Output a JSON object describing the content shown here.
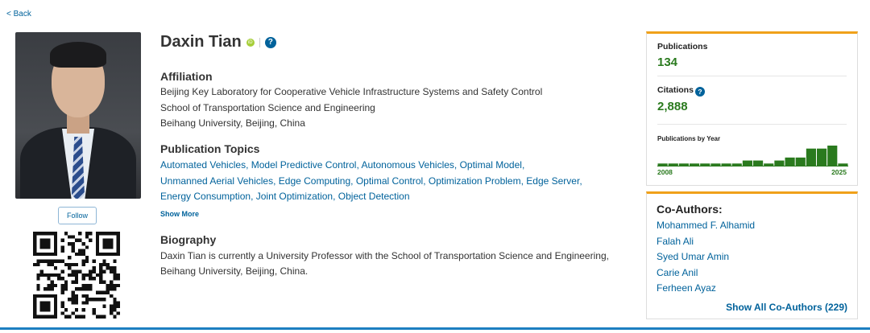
{
  "nav": {
    "back_label": "< Back"
  },
  "profile": {
    "name": "Daxin Tian",
    "orcid_badge": "iD",
    "help_glyph": "?",
    "follow_label": "Follow"
  },
  "affiliation": {
    "heading": "Affiliation",
    "lines": [
      "Beijing Key Laboratory for Cooperative Vehicle Infrastructure Systems and Safety Control",
      "School of Transportation Science and Engineering",
      "Beihang University, Beijing, China"
    ]
  },
  "topics": {
    "heading": "Publication Topics",
    "items": [
      "Automated Vehicles",
      "Model Predictive Control",
      "Autonomous Vehicles",
      "Optimal Model",
      "Unmanned Aerial Vehicles",
      "Edge Computing",
      "Optimal Control",
      "Optimization Problem",
      "Edge Server",
      "Energy Consumption",
      "Joint Optimization",
      "Object Detection"
    ],
    "show_more_label": "Show More"
  },
  "biography": {
    "heading": "Biography",
    "lines": [
      "Daxin Tian is currently a University Professor with the School of Transportation Science and Engineering,",
      "Beihang University, Beijing, China."
    ]
  },
  "metrics": {
    "publications_label": "Publications",
    "publications_value": "134",
    "citations_label": "Citations",
    "citations_value": "2,888",
    "by_year_label": "Publications by Year"
  },
  "chart_data": {
    "type": "bar",
    "categories": [
      "2008",
      "2009",
      "2010",
      "2011",
      "2012",
      "2013",
      "2014",
      "2015",
      "2016",
      "2017",
      "2018",
      "2019",
      "2020",
      "2021",
      "2022",
      "2023",
      "2024",
      "2025"
    ],
    "values": [
      1,
      1,
      1,
      1,
      1,
      1,
      1,
      1,
      2,
      2,
      1,
      2,
      3,
      3,
      6,
      6,
      7,
      1
    ],
    "x_start_label": "2008",
    "x_end_label": "2025",
    "bar_color": "#2a7a1e"
  },
  "coauthors": {
    "heading": "Co-Authors:",
    "names": [
      "Mohammed F. Alhamid",
      "Falah Ali",
      "Syed Umar Amin",
      "Carie Anil",
      "Ferheen Ayaz"
    ],
    "show_all_label": "Show All Co-Authors (229)"
  },
  "colors": {
    "link": "#00629b",
    "accent": "#f0a11a",
    "metric_green": "#2a7a1e",
    "bottom_rule": "#1c7fc1"
  }
}
